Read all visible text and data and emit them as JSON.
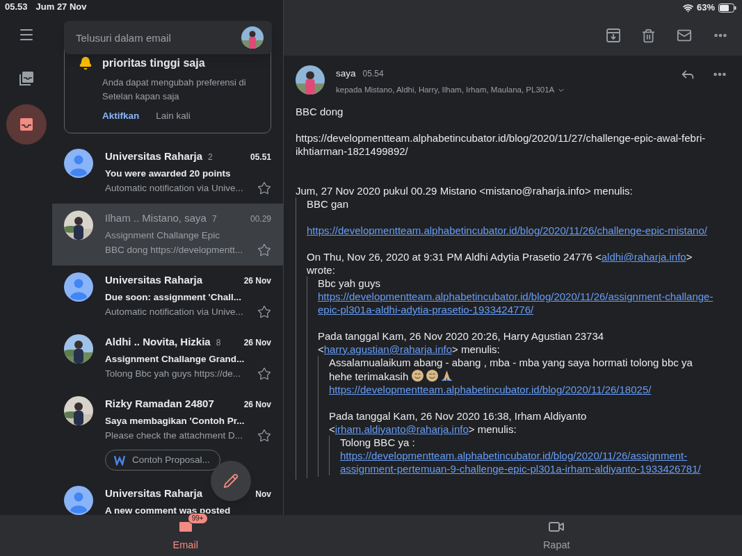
{
  "status_bar": {
    "time": "05.53",
    "date": "Jum 27 Nov",
    "battery": "63%"
  },
  "search": {
    "placeholder": "Telusuri dalam email"
  },
  "rail": [
    {
      "kind": "all_inboxes",
      "selected": false
    },
    {
      "kind": "inbox",
      "selected": true
    }
  ],
  "notice": {
    "title": "prioritas tinggi saja",
    "text": "Anda dapat mengubah preferensi di Setelan kapan saja",
    "actions": [
      {
        "label": "Aktifkan",
        "primary": true
      },
      {
        "label": "Lain kali",
        "primary": false
      }
    ]
  },
  "messages": [
    {
      "kind": "person",
      "sender": "Universitas Raharja",
      "count": "2",
      "date": "05.51",
      "subject": "You were awarded 20 points",
      "snippet": "Automatic notification via Unive...",
      "unread": true,
      "selected": false,
      "starred": false
    },
    {
      "sender": "Ilham .. Mistano, saya",
      "count": "7",
      "date": "00.29",
      "subject": "Assignment Challange Epic",
      "snippet": "BBC dong https://developmentt...",
      "unread": false,
      "selected": true,
      "starred": false
    },
    {
      "kind": "person",
      "sender": "Universitas Raharja",
      "date": "26 Nov",
      "subject": "Due soon: assignment 'Chall...",
      "snippet": "Automatic notification via Unive...",
      "unread": true,
      "selected": false,
      "starred": false
    },
    {
      "sender": "Aldhi .. Novita, Hizkia",
      "count": "8",
      "date": "26 Nov",
      "subject": "Assignment Challange Grand...",
      "snippet": "Tolong Bbc yah guys https://de...",
      "unread": true,
      "selected": false,
      "starred": false
    },
    {
      "sender": "Rizky Ramadan 24807",
      "date": "26 Nov",
      "subject": "Saya membagikan 'Contoh Pr...",
      "snippet": "Please check the attachment D...",
      "unread": true,
      "selected": false,
      "starred": false,
      "attachment": "Contoh Proposal..."
    },
    {
      "kind": "person",
      "sender": "Universitas Raharja",
      "date": "Nov",
      "subject": "A new comment was posted",
      "unread": true,
      "selected": false
    }
  ],
  "message": {
    "sender": "saya",
    "time": "05.54",
    "recipients": "kepada Mistano, Aldhi, Harry, Ilham, Irham, Maulana, PL301A",
    "body": [
      [
        {
          "kind": "text",
          "text": "BBC dong"
        }
      ],
      [
        {
          "kind": "text",
          "text": "https://developmentteam.alphabetincubator.id/blog/2020/11/27/challenge-epic-awal-febri-ikhtiarman-1821499892/"
        }
      ]
    ],
    "quote": {
      "header": [
        {
          "kind": "text",
          "text": "Jum, 27 Nov 2020 pukul 00.29 Mistano <mistano@raharja.info> menulis:"
        }
      ],
      "blocks": [
        [
          {
            "kind": "text",
            "text": "BBC gan"
          }
        ],
        [
          {
            "kind": "url",
            "text": "https://developmentteam.alphabetincubator.id/blog/2020/11/26/challenge-epic-mistano/"
          }
        ]
      ],
      "quote": {
        "header": [
          {
            "kind": "text",
            "text": "On Thu, Nov 26, 2020 at 9:31 PM Aldhi Adytia Prasetio 24776 <"
          },
          {
            "kind": "link",
            "text": "aldhi@raharja.info"
          },
          {
            "kind": "text",
            "text": "> wrote:"
          }
        ],
        "blocks": [
          [
            {
              "kind": "text",
              "text": "Bbc yah guys "
            },
            {
              "kind": "url",
              "text": "https://developmentteam.alphabetincubator.id/blog/2020/11/26/assignment-challange-epic-pl301a-aldhi-adytia-prasetio-1933424776/"
            }
          ]
        ],
        "quote": {
          "header": [
            {
              "kind": "text",
              "text": "Pada tanggal Kam, 26 Nov 2020 20:26, Harry Agustian 23734 <"
            },
            {
              "kind": "link",
              "text": "harry.agustian@raharja.info"
            },
            {
              "kind": "text",
              "text": "> menulis:"
            }
          ],
          "blocks": [
            [
              {
                "kind": "text",
                "text": "Assalamualaikum abang - abang , mba - mba yang saya hormati tolong bbc ya hehe terimakasih "
              },
              {
                "kind": "smile"
              },
              {
                "kind": "smile"
              },
              {
                "kind": "pray"
              },
              {
                "kind": "url",
                "text": "https://developmentteam.alphabetincubator.id/blog/2020/11/26/18025/"
              }
            ]
          ],
          "quote": {
            "header": [
              {
                "kind": "text",
                "text": "Pada tanggal Kam, 26 Nov 2020 16:38, Irham Aldiyanto <"
              },
              {
                "kind": "link",
                "text": "irham.aldiyanto@raharja.info"
              },
              {
                "kind": "text",
                "text": "> menulis:"
              }
            ],
            "blocks": [
              [
                {
                  "kind": "text",
                  "text": "Tolong BBC ya :"
                },
                {
                  "kind": "url",
                  "text": "https://developmentteam.alphabetincubator.id/blog/2020/11/26/assignment-assignment-pertemuan-9-challenge-epic-pl301a-irham-aldiyanto-1933426781/"
                }
              ]
            ]
          }
        }
      }
    }
  },
  "bottom_nav": [
    {
      "kind": "email",
      "label": "Email",
      "badge": "99+",
      "selected": true
    },
    {
      "kind": "meet",
      "label": "Rapat",
      "selected": false
    }
  ]
}
